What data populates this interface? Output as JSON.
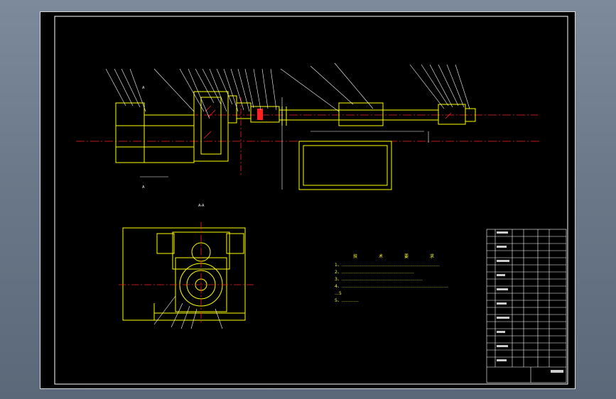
{
  "colors": {
    "background_chrome": "#6a7889",
    "viewport": "#000000",
    "frame": "#ffffff",
    "parts": "#ffff00",
    "centerlines": "#ff2020",
    "dimensions": "#ffffff",
    "notes": "#ffff33"
  },
  "technical_notes": {
    "title": "技 术 要 求",
    "items": [
      "1、……………………………………………………………",
      "2、……………………………………………",
      "3、…………………………………………………",
      "4、…………………………………………………………………",
      "…5",
      "5、…………"
    ]
  },
  "view_labels": {
    "main_left": "A",
    "main_bottom": "A",
    "section_view": "A-A"
  },
  "title_block": {
    "drawing_name": "",
    "bottom_label": ""
  }
}
